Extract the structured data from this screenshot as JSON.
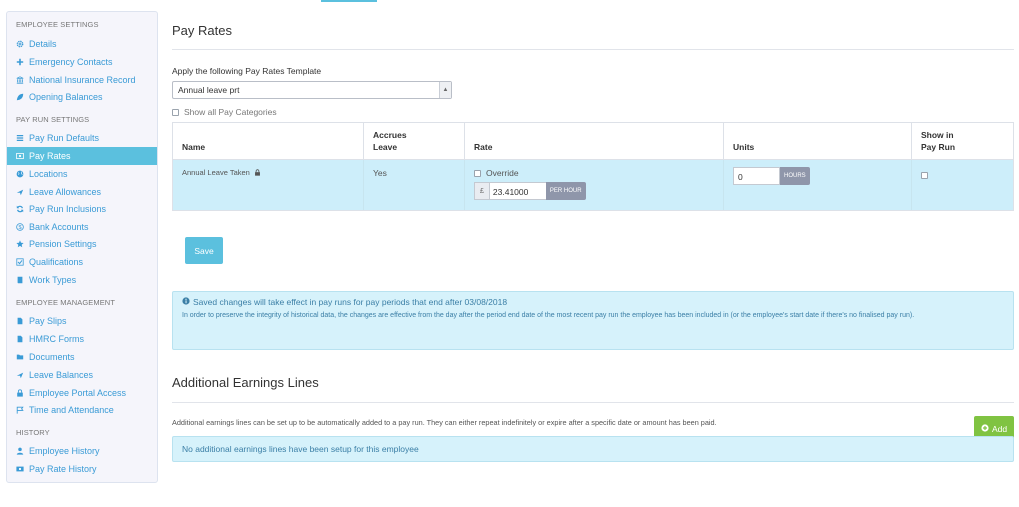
{
  "sidebar": {
    "sections": [
      {
        "title": "EMPLOYEE SETTINGS",
        "items": [
          {
            "label": "Details",
            "icon": "gear-icon"
          },
          {
            "label": "Emergency Contacts",
            "icon": "plus-icon"
          },
          {
            "label": "National Insurance Record",
            "icon": "building-icon"
          },
          {
            "label": "Opening Balances",
            "icon": "leaf-icon"
          }
        ]
      },
      {
        "title": "PAY RUN SETTINGS",
        "items": [
          {
            "label": "Pay Run Defaults",
            "icon": "list-icon"
          },
          {
            "label": "Pay Rates",
            "icon": "money-icon",
            "active": true
          },
          {
            "label": "Locations",
            "icon": "globe-icon"
          },
          {
            "label": "Leave Allowances",
            "icon": "plane-icon"
          },
          {
            "label": "Pay Run Inclusions",
            "icon": "refresh-icon"
          },
          {
            "label": "Bank Accounts",
            "icon": "dollar-circle-icon"
          },
          {
            "label": "Pension Settings",
            "icon": "star-icon"
          },
          {
            "label": "Qualifications",
            "icon": "checkbox-icon"
          },
          {
            "label": "Work Types",
            "icon": "book-icon"
          }
        ]
      },
      {
        "title": "EMPLOYEE MANAGEMENT",
        "items": [
          {
            "label": "Pay Slips",
            "icon": "file-icon"
          },
          {
            "label": "HMRC Forms",
            "icon": "file-icon"
          },
          {
            "label": "Documents",
            "icon": "folder-icon"
          },
          {
            "label": "Leave Balances",
            "icon": "plane-icon"
          },
          {
            "label": "Employee Portal Access",
            "icon": "lock-icon"
          },
          {
            "label": "Time and Attendance",
            "icon": "flag-icon"
          }
        ]
      },
      {
        "title": "HISTORY",
        "items": [
          {
            "label": "Employee History",
            "icon": "user-icon"
          },
          {
            "label": "Pay Rate History",
            "icon": "money-history-icon"
          }
        ]
      }
    ]
  },
  "main": {
    "title": "Pay Rates",
    "template_label": "Apply the following Pay Rates Template",
    "template_value": "Annual leave prt",
    "show_all_label": "Show all Pay Categories",
    "table": {
      "headers": {
        "name": "Name",
        "accrues": [
          "Accrues",
          "Leave"
        ],
        "rate": "Rate",
        "units": "Units",
        "show": [
          "Show in",
          "Pay Run"
        ]
      },
      "rows": [
        {
          "name": "Annual Leave Taken",
          "accrues": "Yes",
          "override_label": "Override",
          "currency": "£",
          "rate": "23.41000",
          "rate_unit": "PER HOUR",
          "units": "0",
          "units_unit": "HOURS"
        }
      ]
    },
    "save_label": "Save",
    "info": {
      "title": "Saved changes will take effect in pay runs for pay periods that end after 03/08/2018",
      "text": "In order to preserve the integrity of historical data, the changes are effective from the day after the period end date of the most recent pay run the employee has been included in (or the employee's start date if there's no finalised pay run)."
    },
    "earnings": {
      "title": "Additional Earnings Lines",
      "description": "Additional earnings lines can be set up to be automatically added to a pay run. They can either repeat indefinitely or expire after a specific date or amount has been paid.",
      "add_label": "Add",
      "empty_text": "No additional earnings lines have been setup for this employee"
    }
  },
  "colors": {
    "accent": "#5bc0de",
    "add_green": "#80c342",
    "link": "#3a9bd6"
  }
}
